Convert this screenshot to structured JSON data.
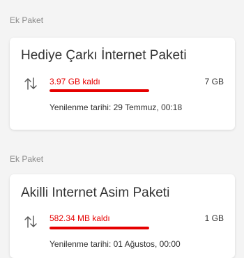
{
  "packages": [
    {
      "section_label": "Ek Paket",
      "title": "Hediye Çarkı İnternet Paketi",
      "remaining": "3.97 GB kaldı",
      "total": "7 GB",
      "fill_fraction": 1.0,
      "renewal": "Yenilenme tarihi: 29 Temmuz, 00:18"
    },
    {
      "section_label": "Ek Paket",
      "title": "Akilli Internet Asim Paketi",
      "remaining": "582.34 MB kaldı",
      "total": "1 GB",
      "fill_fraction": 1.0,
      "renewal": "Yenilenme tarihi: 01 Ağustos, 00:00"
    }
  ],
  "colors": {
    "accent": "#e60000",
    "background": "#f4f4f4",
    "card": "#ffffff"
  },
  "icons": {
    "usage": "up-down-arrows-icon"
  }
}
